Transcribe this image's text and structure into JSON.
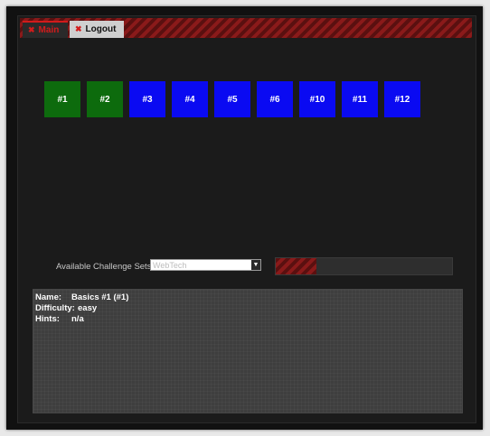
{
  "tabs": {
    "main": "Main",
    "logout": "Logout"
  },
  "challenges": [
    {
      "label": "#1",
      "status": "solved"
    },
    {
      "label": "#2",
      "status": "solved"
    },
    {
      "label": "#3",
      "status": "open"
    },
    {
      "label": "#4",
      "status": "open"
    },
    {
      "label": "#5",
      "status": "open"
    },
    {
      "label": "#6",
      "status": "open"
    },
    {
      "label": "#10",
      "status": "open"
    },
    {
      "label": "#11",
      "status": "open"
    },
    {
      "label": "#12",
      "status": "open"
    }
  ],
  "sets": {
    "label": "Available Challenge Sets:",
    "selected": "WebTech"
  },
  "progress": {
    "fraction": 0.23
  },
  "details": {
    "name_key": "Name:",
    "name_value": "Basics #1 (#1)",
    "difficulty_key": "Difficulty:",
    "difficulty_value": "easy",
    "hints_key": "Hints:",
    "hints_value": "n/a"
  },
  "colors": {
    "solved": "#0d6b0d",
    "open": "#0a0af2",
    "accent": "#d21b1b"
  }
}
